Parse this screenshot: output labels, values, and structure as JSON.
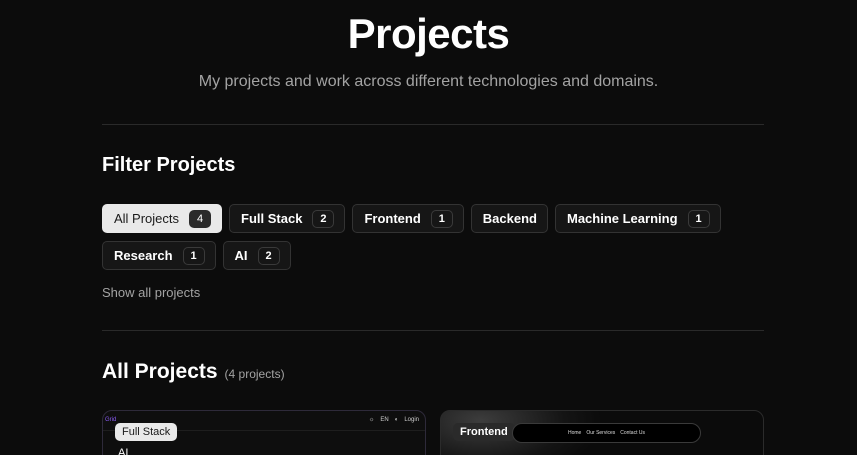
{
  "header": {
    "title": "Projects",
    "subtitle": "My projects and work across different technologies and domains."
  },
  "filters": {
    "heading": "Filter Projects",
    "chips": [
      {
        "label": "All Projects",
        "count": "4",
        "active": true
      },
      {
        "label": "Full Stack",
        "count": "2"
      },
      {
        "label": "Frontend",
        "count": "1"
      },
      {
        "label": "Backend",
        "count": ""
      },
      {
        "label": "Machine Learning",
        "count": "1"
      },
      {
        "label": "Research",
        "count": "1"
      },
      {
        "label": "AI",
        "count": "2"
      }
    ],
    "show_all": "Show all projects"
  },
  "projects": {
    "heading": "All Projects",
    "count_text": "(4 projects)",
    "cards": [
      {
        "tag": "Full Stack",
        "tag2": "AI",
        "mini_logo": "Grid",
        "mini_icons": [
          "☼",
          "EN",
          "◐",
          "Login"
        ]
      },
      {
        "tag": "Frontend",
        "mini_nav": [
          "Home",
          "Our Services",
          "Contact Us"
        ]
      }
    ]
  },
  "colors": {
    "background": "#0c0c0c",
    "active_chip": "#e9e9e9",
    "muted_text": "#a3a3a3",
    "accent_purple": "#8b5cf6"
  }
}
